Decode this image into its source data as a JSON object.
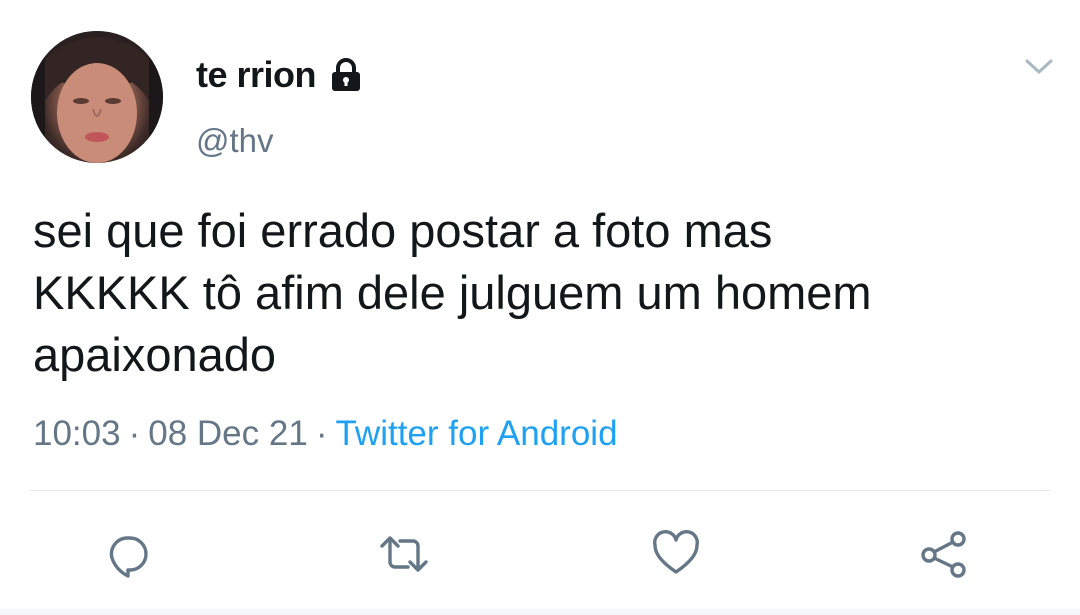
{
  "user": {
    "display_name": "te rrion",
    "handle": "@thv",
    "protected_icon": "lock-icon",
    "avatar": "profile-photo"
  },
  "tweet": {
    "text": "sei que foi errado postar a foto mas\nKKKKK tô afim dele julguem um homem\napaixonado",
    "time": "10:03",
    "date": "08 Dec 21",
    "separator": "·",
    "source": "Twitter for Android"
  },
  "actions": {
    "reply_icon": "reply-icon",
    "retweet_icon": "retweet-icon",
    "like_icon": "heart-icon",
    "share_icon": "share-icon",
    "menu_icon": "chevron-down-icon"
  },
  "colors": {
    "text": "#14171a",
    "secondary": "#657786",
    "accent": "#1da1f2",
    "divider": "#e1e8ed"
  }
}
